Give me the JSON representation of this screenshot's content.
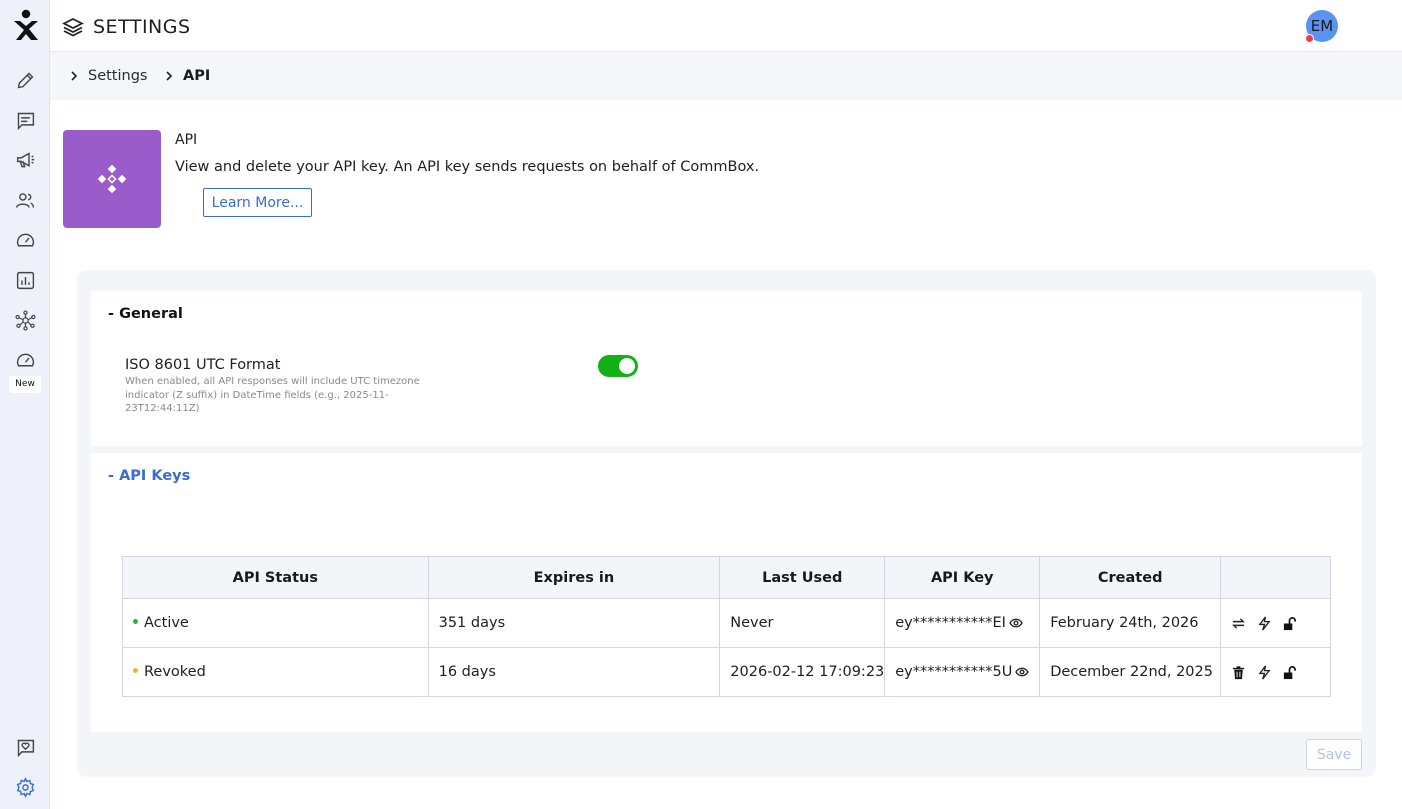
{
  "header": {
    "title": "SETTINGS",
    "avatar_initials": "EM"
  },
  "sidebar": {
    "items": [
      {
        "name": "pencil-icon"
      },
      {
        "name": "chat-icon"
      },
      {
        "name": "megaphone-icon"
      },
      {
        "name": "users-icon"
      },
      {
        "name": "speedometer-icon"
      },
      {
        "name": "bar-chart-icon"
      },
      {
        "name": "network-icon"
      },
      {
        "name": "speedometer-new-icon"
      }
    ],
    "new_badge": "New",
    "bottom": [
      {
        "name": "heart-chat-icon"
      },
      {
        "name": "gear-icon"
      }
    ]
  },
  "breadcrumb": {
    "items": [
      "Settings",
      "API"
    ]
  },
  "intro": {
    "title": "API",
    "description": "View and delete your API key. An API key sends requests on behalf of CommBox.",
    "learn_more": "Learn More..."
  },
  "general": {
    "title": "- General",
    "iso_label": "ISO 8601 UTC Format",
    "iso_description": "When enabled, all API responses will include UTC timezone indicator (Z suffix) in DateTime fields (e.g., 2025-11-23T12:44:11Z)",
    "iso_enabled": true
  },
  "api_keys": {
    "title": "- API Keys",
    "columns": [
      "API Status",
      "Expires in",
      "Last Used",
      "API Key",
      "Created",
      ""
    ],
    "rows": [
      {
        "status": "Active",
        "status_color": "#2eb82e",
        "expires": "351 days",
        "last_used": "Never",
        "key": "ey***********EI",
        "created": "February 24th, 2026",
        "actions": [
          "rotate-icon",
          "lightning-icon",
          "unlock-icon"
        ]
      },
      {
        "status": "Revoked",
        "status_color": "#f2b132",
        "expires": "16 days",
        "last_used": "2026-02-12 17:09:23",
        "key": "ey***********5U",
        "created": "December 22nd, 2025",
        "actions": [
          "trash-icon",
          "lightning-icon",
          "unlock-icon"
        ]
      }
    ]
  },
  "footer": {
    "save_label": "Save"
  },
  "colors": {
    "accent": "#3a6ad4",
    "tile": "#9b5ccb",
    "toggle_on": "#13b113",
    "sidebar_bg": "#eef1fa"
  }
}
